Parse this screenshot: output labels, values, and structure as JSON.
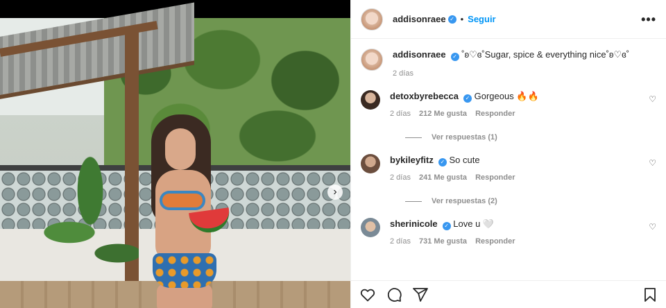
{
  "post": {
    "author": "addisonraee",
    "follow_label": "Seguir",
    "separator": "•",
    "more_label": "•••"
  },
  "caption": {
    "username": "addisonraee",
    "text": "˚ʚ♡ɞ˚Sugar, spice & everything nice˚ʚ♡ɞ˚",
    "time": "2 días"
  },
  "comments": [
    {
      "username": "detoxbyrebecca",
      "text": "Gorgeous 🔥🔥",
      "time": "2 días",
      "likes": "212 Me gusta",
      "reply_label": "Responder",
      "view_replies": "Ver respuestas (1)"
    },
    {
      "username": "bykileyfitz",
      "text": "So cute",
      "time": "2 días",
      "likes": "241 Me gusta",
      "reply_label": "Responder",
      "view_replies": "Ver respuestas (2)"
    },
    {
      "username": "sherinicole",
      "text": "Love u 🤍",
      "time": "2 días",
      "likes": "731 Me gusta",
      "reply_label": "Responder"
    }
  ],
  "icons": {
    "verified": "✓",
    "next": "›",
    "heart_small": "♡",
    "like": "heart-icon",
    "comment": "comment-icon",
    "share": "share-icon",
    "save": "bookmark-icon"
  },
  "colors": {
    "accent": "#0095f6",
    "verified": "#3897f0",
    "muted": "#8e8e8e",
    "text": "#262626"
  }
}
